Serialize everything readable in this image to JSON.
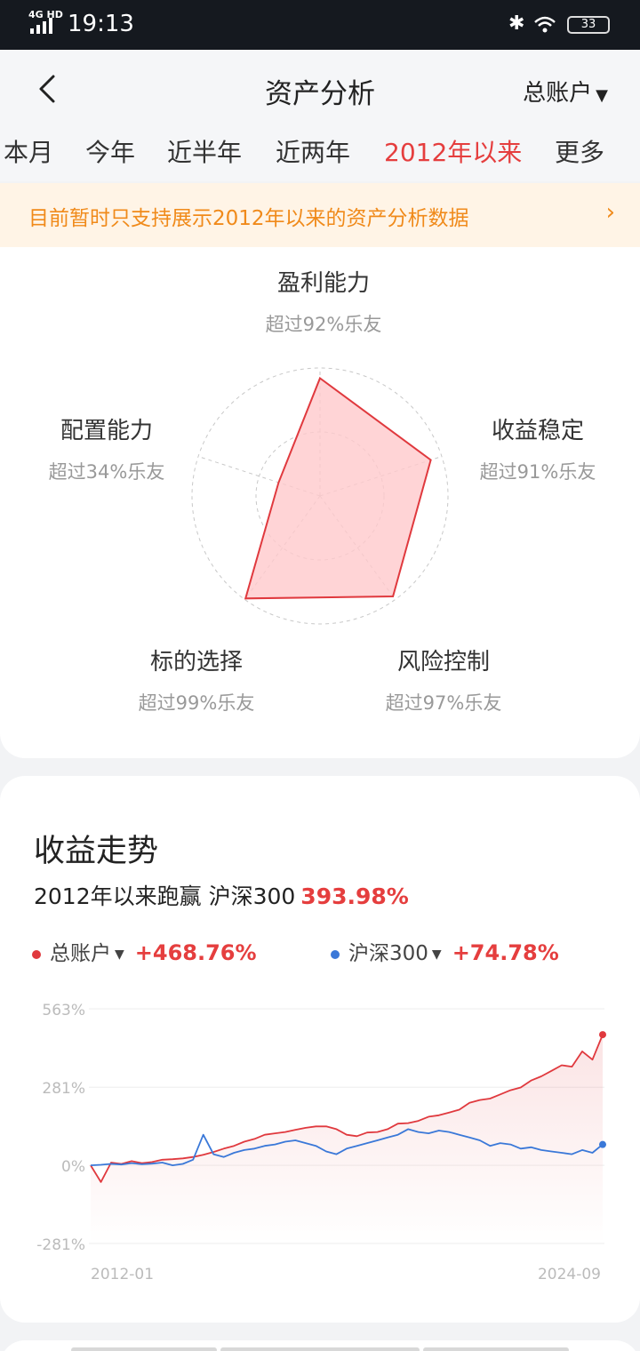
{
  "status": {
    "network": "4G HD",
    "time": "19:13",
    "battery": "33",
    "icons": [
      "signal-icon",
      "bluetooth-icon",
      "wifi-icon",
      "battery-icon"
    ]
  },
  "nav": {
    "back_icon": "chevron-left-icon",
    "title": "资产分析",
    "account": "总账户",
    "account_icon": "caret-down-icon"
  },
  "tabs": [
    {
      "label": "本月"
    },
    {
      "label": "今年"
    },
    {
      "label": "近半年"
    },
    {
      "label": "近两年"
    },
    {
      "label": "2012年以来",
      "active": true
    },
    {
      "label": "更多"
    }
  ],
  "notice": {
    "text": "目前暂时只支持展示2012年以来的资产分析数据",
    "arrow_icon": "chevron-right-icon"
  },
  "radar": {
    "axes": [
      {
        "name": "盈利能力",
        "pct": "超过92%乐友",
        "value": 0.92
      },
      {
        "name": "收益稳定",
        "pct": "超过91%乐友",
        "value": 0.91
      },
      {
        "name": "风险控制",
        "pct": "超过97%乐友",
        "value": 0.97
      },
      {
        "name": "标的选择",
        "pct": "超过99%乐友",
        "value": 0.99
      },
      {
        "name": "配置能力",
        "pct": "超过34%乐友",
        "value": 0.34
      }
    ],
    "colors": {
      "fill": "#ffc9cc",
      "stroke": "#e0393e",
      "grid": "#c8c8c8"
    }
  },
  "trend": {
    "title": "收益走势",
    "summary_text": "2012年以来跑赢 沪深300",
    "summary_value": "393.98%",
    "legend": [
      {
        "name": "总账户",
        "value": "+468.76%",
        "color": "#e0393e"
      },
      {
        "name": "沪深300",
        "value": "+74.78%",
        "color": "#3a78d8"
      }
    ]
  },
  "chart_data": {
    "type": "line",
    "x_labels": [
      "2012-01",
      "2024-09"
    ],
    "y_ticks": [
      "563%",
      "281%",
      "0%",
      "-281%"
    ],
    "ylim": [
      -281,
      563
    ],
    "series": [
      {
        "name": "总账户",
        "color": "#e0393e",
        "values": [
          0,
          -60,
          10,
          5,
          15,
          8,
          12,
          20,
          22,
          25,
          30,
          38,
          48,
          60,
          70,
          85,
          95,
          110,
          115,
          120,
          128,
          135,
          140,
          140,
          130,
          110,
          105,
          118,
          120,
          130,
          150,
          152,
          160,
          175,
          180,
          190,
          200,
          225,
          235,
          240,
          255,
          270,
          280,
          305,
          320,
          340,
          360,
          355,
          410,
          380,
          470
        ]
      },
      {
        "name": "沪深300",
        "color": "#3a78d8",
        "values": [
          0,
          2,
          5,
          3,
          8,
          4,
          6,
          10,
          0,
          5,
          20,
          110,
          40,
          30,
          45,
          55,
          60,
          70,
          75,
          85,
          90,
          80,
          70,
          50,
          40,
          60,
          70,
          80,
          90,
          100,
          110,
          130,
          120,
          115,
          125,
          120,
          110,
          100,
          90,
          70,
          80,
          75,
          60,
          65,
          55,
          50,
          45,
          40,
          55,
          45,
          75
        ]
      }
    ]
  }
}
